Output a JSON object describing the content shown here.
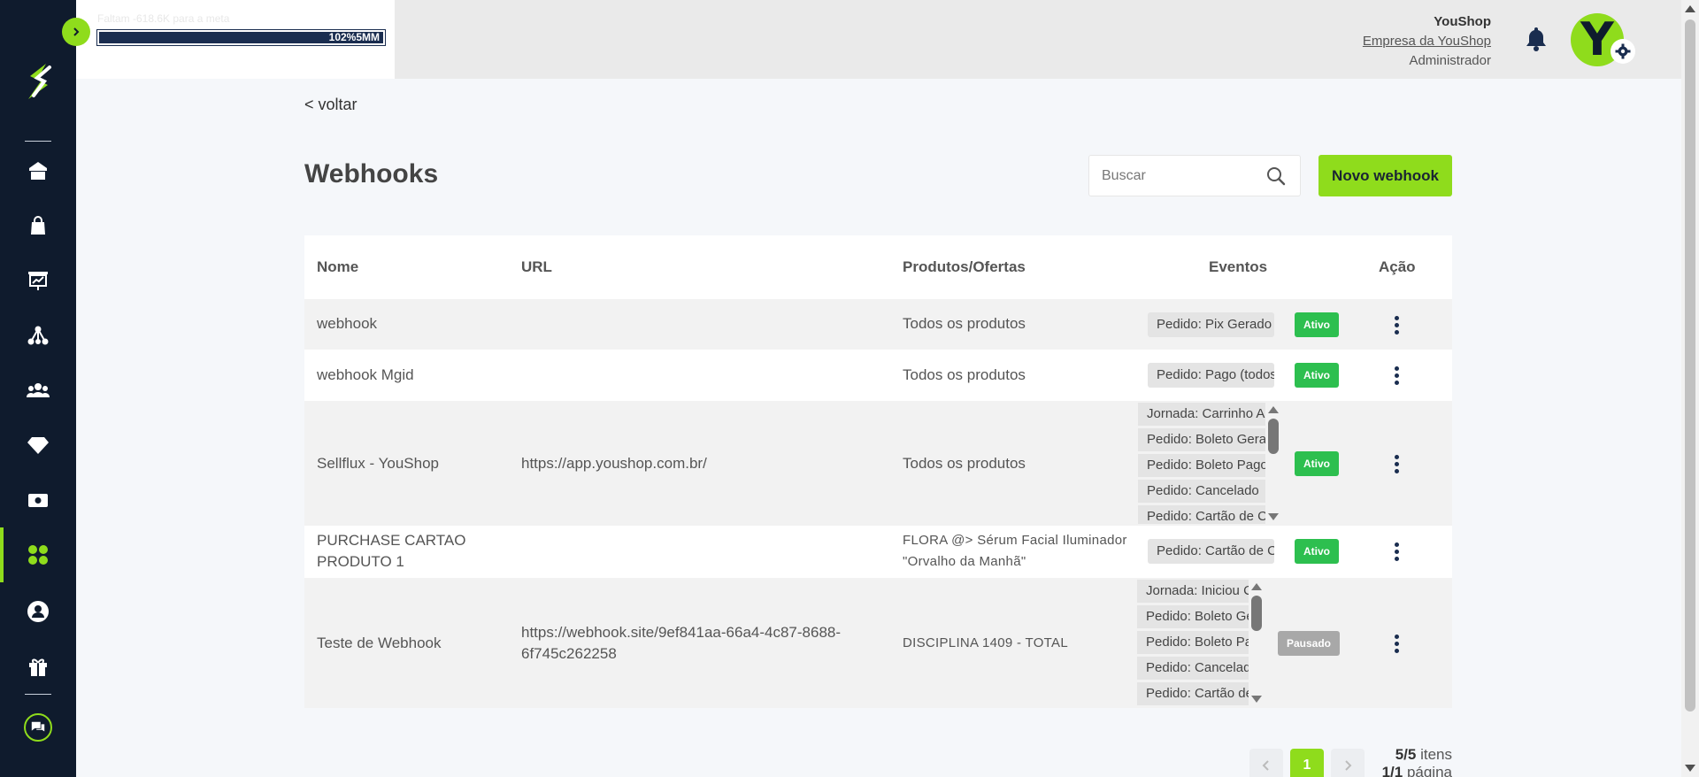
{
  "goal": {
    "text": "Faltam -618.6K para a meta",
    "progress_label": "102%5MM",
    "progress_percent": 100
  },
  "user": {
    "name": "YouShop",
    "company": "Empresa da YouShop",
    "role": "Administrador",
    "avatar_letter": "Y"
  },
  "nav": {
    "back": "< voltar"
  },
  "sidebar": {
    "items": [
      "store-icon",
      "bag-icon",
      "presentation-icon",
      "network-icon",
      "users-icon",
      "diamond-icon",
      "money-icon",
      "apps-icon",
      "account-icon",
      "gift-icon"
    ],
    "active": "apps-icon"
  },
  "page": {
    "title": "Webhooks",
    "search_placeholder": "Buscar",
    "new_button": "Novo webhook"
  },
  "table": {
    "headers": {
      "nome": "Nome",
      "url": "URL",
      "produtos": "Produtos/Ofertas",
      "eventos": "Eventos",
      "acao": "Ação"
    },
    "rows": [
      {
        "nome": "webhook",
        "url": "",
        "produtos": "Todos os produtos",
        "eventos": [
          "Pedido: Pix Gerado"
        ],
        "status": "Ativo"
      },
      {
        "nome": "webhook Mgid",
        "url": "",
        "produtos": "Todos os produtos",
        "eventos": [
          "Pedido: Pago (todos"
        ],
        "status": "Ativo"
      },
      {
        "nome": "Sellflux - YouShop",
        "url": "https://app.youshop.com.br/",
        "produtos": "Todos os produtos",
        "eventos": [
          "Jornada: Carrinho Ab",
          "Pedido: Boleto Gera",
          "Pedido: Boleto Pago",
          "Pedido: Cancelado",
          "Pedido: Cartão de Cr"
        ],
        "status": "Ativo"
      },
      {
        "nome": "PURCHASE CARTAO PRODUTO 1",
        "url": "",
        "produtos": "FLORA @> Sérum Facial Iluminador \"Orvalho da Manhã\"",
        "eventos": [
          "Pedido: Cartão de Cr"
        ],
        "status": "Ativo"
      },
      {
        "nome": "Teste de Webhook",
        "url": "https://webhook.site/9ef841aa-66a4-4c87-8688-6f745c262258",
        "produtos": "DISCIPLINA 1409 - TOTAL",
        "eventos": [
          "Jornada: Iniciou Ch",
          "Pedido: Boleto Ge",
          "Pedido: Boleto Pa",
          "Pedido: Cancelado",
          "Pedido: Cartão de"
        ],
        "status": "Pausado"
      }
    ]
  },
  "pagination": {
    "current": "1",
    "items_count": "5/5",
    "items_label": "itens",
    "pages_count": "1/1",
    "pages_label": "página"
  },
  "colors": {
    "sidebar": "#0f1b2d",
    "accent": "#8fdc1c",
    "active_badge": "#2dbf4f",
    "paused_badge": "#a8a8a8"
  }
}
